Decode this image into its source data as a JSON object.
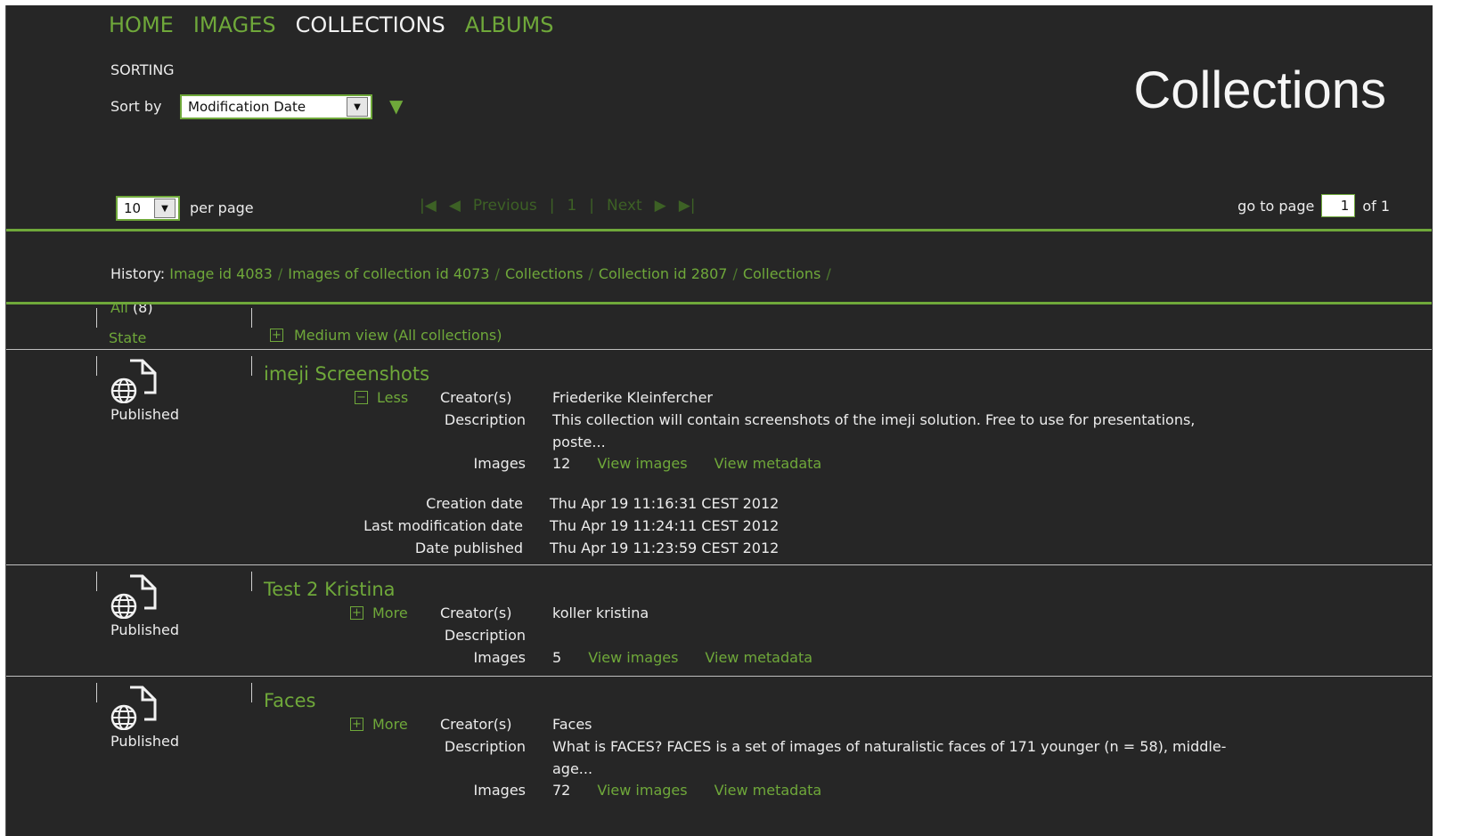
{
  "nav": {
    "home": "HOME",
    "images": "IMAGES",
    "collections": "COLLECTIONS",
    "albums": "ALBUMS"
  },
  "sorting": {
    "title": "SORTING",
    "sort_by_label": "Sort by",
    "selected": "Modification Date"
  },
  "page_title": "Collections",
  "pagination": {
    "per_page_value": "10",
    "per_page_label": "per page",
    "previous": "Previous",
    "current": "1",
    "next": "Next",
    "goto_label": "go to page",
    "goto_value": "1",
    "of_label": "of 1"
  },
  "history": {
    "label": "History:",
    "items": [
      "Image id 4083",
      "Images of collection id 4073",
      "Collections",
      "Collection id 2807",
      "Collections"
    ],
    "all_label": "All",
    "all_count": "(8)"
  },
  "columns": {
    "state": "State",
    "view_toggle": "Medium view (All collections)"
  },
  "labels": {
    "creators": "Creator(s)",
    "description": "Description",
    "images": "Images",
    "view_images": "View images",
    "view_metadata": "View metadata",
    "creation_date": "Creation date",
    "last_modification_date": "Last modification date",
    "date_published": "Date published",
    "less": "Less",
    "more": "More"
  },
  "collections": [
    {
      "state": "Published",
      "title": "imeji Screenshots",
      "creators": "Friederike Kleinfercher",
      "description_line1": "This collection will contain screenshots of the imeji solution. Free to use for presentations,",
      "description_line2": "poste...",
      "images_count": "12",
      "creation_date": "Thu Apr 19 11:16:31 CEST 2012",
      "last_modification_date": "Thu Apr 19 11:24:11 CEST 2012",
      "date_published": "Thu Apr 19 11:23:59 CEST 2012"
    },
    {
      "state": "Published",
      "title": "Test 2 Kristina",
      "creators": "koller kristina",
      "images_count": "5"
    },
    {
      "state": "Published",
      "title": "Faces",
      "creators": "Faces",
      "description_line1": "What is FACES? FACES is a set of images of naturalistic faces of 171 younger (n = 58), middle-",
      "description_line2": "age...",
      "images_count": "72"
    }
  ]
}
